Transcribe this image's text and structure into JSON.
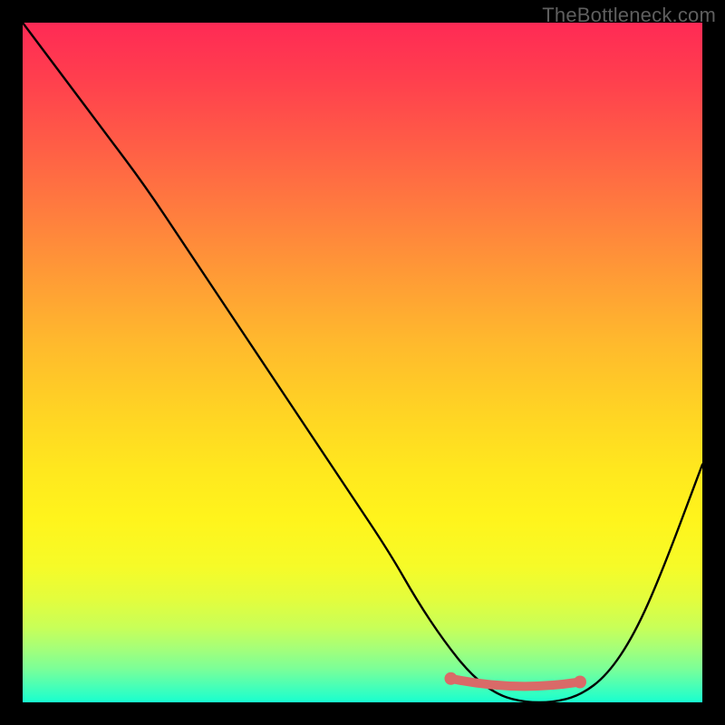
{
  "watermark": "TheBottleneck.com",
  "chart_data": {
    "type": "line",
    "title": "",
    "xlabel": "",
    "ylabel": "",
    "xlim": [
      0,
      100
    ],
    "ylim": [
      0,
      100
    ],
    "series": [
      {
        "name": "bottleneck-curve",
        "x": [
          0,
          6,
          12,
          18,
          24,
          30,
          36,
          42,
          48,
          54,
          58,
          62,
          66,
          70,
          74,
          78,
          82,
          86,
          90,
          94,
          100
        ],
        "values": [
          100,
          92,
          84,
          76,
          67,
          58,
          49,
          40,
          31,
          22,
          15,
          9,
          4,
          1,
          0,
          0,
          1,
          4,
          10,
          19,
          35
        ]
      }
    ],
    "markers": [
      {
        "name": "flat-region-left",
        "x": 63,
        "y": 3.5,
        "color": "#d96a68"
      },
      {
        "name": "flat-region-right",
        "x": 82,
        "y": 3.0,
        "color": "#d96a68"
      }
    ],
    "flat_segment": {
      "x_start": 63,
      "x_end": 82,
      "y": 3.0,
      "color": "#d96a68"
    },
    "background_gradient": {
      "top": "#ff2a55",
      "mid": "#ffe81e",
      "bottom": "#18ffcf"
    }
  }
}
